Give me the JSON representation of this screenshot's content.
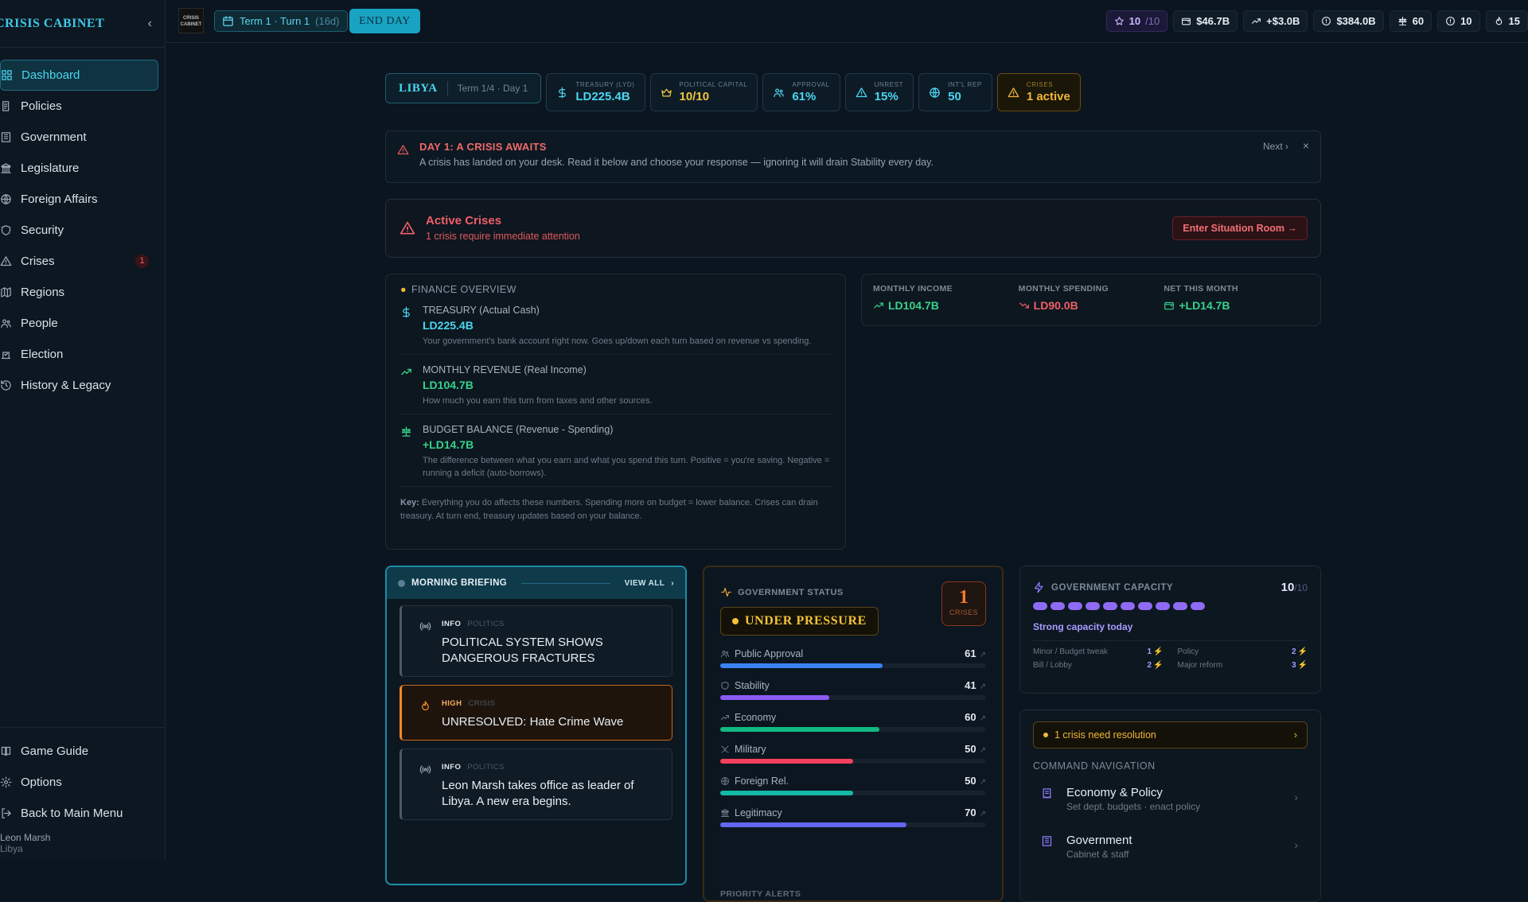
{
  "app": {
    "title": "CRISIS CABINET",
    "collapse_icon": "chevron-left-icon",
    "logo_text": "CRISIS CABINET"
  },
  "sidebar": {
    "items": [
      {
        "label": "Dashboard",
        "icon": "grid-icon",
        "active": true
      },
      {
        "label": "Policies",
        "icon": "scroll-icon"
      },
      {
        "label": "Government",
        "icon": "building-icon"
      },
      {
        "label": "Legislature",
        "icon": "landmark-icon"
      },
      {
        "label": "Foreign Affairs",
        "icon": "globe-icon"
      },
      {
        "label": "Security",
        "icon": "shield-icon"
      },
      {
        "label": "Crises",
        "icon": "warning-icon",
        "badge": "1"
      },
      {
        "label": "Regions",
        "icon": "map-icon"
      },
      {
        "label": "People",
        "icon": "people-icon"
      },
      {
        "label": "Election",
        "icon": "ballot-icon"
      },
      {
        "label": "History & Legacy",
        "icon": "history-icon"
      }
    ],
    "bottom": [
      {
        "label": "Game Guide",
        "icon": "book-icon"
      },
      {
        "label": "Options",
        "icon": "gear-icon"
      },
      {
        "label": "Back to Main Menu",
        "icon": "logout-icon"
      }
    ],
    "user": {
      "name": "Leon Marsh",
      "country": "Libya"
    }
  },
  "topbar": {
    "term": "Term 1 · Turn 1",
    "term_days": "(16d)",
    "end_day": "END DAY",
    "stats": [
      {
        "icon": "star-icon",
        "value": "10",
        "suffix": "/10",
        "kind": "cap"
      },
      {
        "icon": "wallet-icon",
        "value": "$46.7B"
      },
      {
        "icon": "trend-up-icon",
        "value": "+$3.0B"
      },
      {
        "icon": "alert-circle-icon",
        "value": "$384.0B"
      },
      {
        "icon": "scale-icon",
        "value": "60"
      },
      {
        "icon": "alert-circle-icon",
        "value": "10"
      },
      {
        "icon": "flame-icon",
        "value": "15"
      }
    ]
  },
  "country_bar": {
    "name": "LIBYA",
    "term": "Term 1/4 · Day 1",
    "chips": [
      {
        "label": "TREASURY (LYD)",
        "value": "LD225.4B",
        "icon": "dollar-icon"
      },
      {
        "label": "POLITICAL CAPITAL",
        "value": "10/10",
        "icon": "crown-icon",
        "kind": "cap"
      },
      {
        "label": "APPROVAL",
        "value": "61%",
        "icon": "people-icon"
      },
      {
        "label": "UNREST",
        "value": "15%",
        "icon": "warning-icon"
      },
      {
        "label": "INT'L REP",
        "value": "50",
        "icon": "globe-icon"
      },
      {
        "label": "CRISES",
        "value": "1 active",
        "icon": "warning-icon",
        "kind": "warn"
      }
    ]
  },
  "day_alert": {
    "title": "DAY 1: A CRISIS AWAITS",
    "text": "A crisis has landed on your desk. Read it below and choose your response — ignoring it will drain Stability every day.",
    "next": "Next ›",
    "close": "×"
  },
  "active_crises": {
    "title": "Active Crises",
    "subtitle": "1 crisis require immediate attention",
    "button": "Enter Situation Room →"
  },
  "finance": {
    "title": "FINANCE OVERVIEW",
    "rows": [
      {
        "icon": "dollar-icon",
        "title": "TREASURY (Actual Cash)",
        "value": "LD225.4B",
        "color": "#4bd6f0",
        "desc": "Your government's bank account right now. Goes up/down each turn based on revenue vs spending."
      },
      {
        "icon": "trend-up-icon",
        "title": "MONTHLY REVENUE (Real Income)",
        "value": "LD104.7B",
        "color": "#37d38b",
        "desc": "How much you earn this turn from taxes and other sources."
      },
      {
        "icon": "scale-icon",
        "title": "BUDGET BALANCE (Revenue - Spending)",
        "value": "+LD14.7B",
        "color": "#37d38b",
        "desc": "The difference between what you earn and what you spend this turn. Positive = you're saving. Negative = running a deficit (auto-borrows)."
      }
    ],
    "key_label": "Key:",
    "key_text": "Everything you do affects these numbers. Spending more on budget = lower balance. Crises can drain treasury. At turn end, treasury updates based on your balance."
  },
  "monthly": [
    {
      "label": "MONTHLY INCOME",
      "value": "LD104.7B",
      "icon": "trend-up-icon",
      "color": "#37d38b"
    },
    {
      "label": "MONTHLY SPENDING",
      "value": "LD90.0B",
      "icon": "trend-down-icon",
      "color": "#f05f66"
    },
    {
      "label": "NET THIS MONTH",
      "value": "+LD14.7B",
      "icon": "wallet-icon",
      "color": "#37d38b"
    }
  ],
  "briefing": {
    "title": "MORNING BRIEFING",
    "view_all": "VIEW ALL",
    "items": [
      {
        "tag": "INFO",
        "category": "POLITICS",
        "text": "POLITICAL SYSTEM SHOWS DANGEROUS FRACTURES",
        "icon": "broadcast-icon",
        "level": "info"
      },
      {
        "tag": "HIGH",
        "category": "CRISIS",
        "text": "UNRESOLVED: Hate Crime Wave",
        "icon": "flame-icon",
        "level": "high"
      },
      {
        "tag": "INFO",
        "category": "POLITICS",
        "text": "Leon Marsh takes office as leader of Libya. A new era begins.",
        "icon": "broadcast-icon",
        "level": "info"
      }
    ]
  },
  "gov_status": {
    "title": "GOVERNMENT STATUS",
    "status": "UNDER PRESSURE",
    "crises_count": "1",
    "crises_label": "CRISES",
    "metrics": [
      {
        "label": "Public Approval",
        "value": 61,
        "color": "#3b82f6",
        "icon": "people-icon"
      },
      {
        "label": "Stability",
        "value": 41,
        "color": "#8b5cf6",
        "icon": "shield-icon"
      },
      {
        "label": "Economy",
        "value": 60,
        "color": "#10b981",
        "icon": "trend-up-icon"
      },
      {
        "label": "Military",
        "value": 50,
        "color": "#f43f5e",
        "icon": "swords-icon"
      },
      {
        "label": "Foreign Rel.",
        "value": 50,
        "color": "#14b8a6",
        "icon": "globe-icon"
      },
      {
        "label": "Legitimacy",
        "value": 70,
        "color": "#6366f1",
        "icon": "landmark-icon"
      }
    ],
    "priority": "PRIORITY ALERTS"
  },
  "capacity": {
    "title": "GOVERNMENT CAPACITY",
    "value": "10",
    "max": "/10",
    "pips": 10,
    "strong": "Strong capacity today",
    "costs": [
      {
        "label": "Minor / Budget tweak",
        "cost": "1"
      },
      {
        "label": "Policy",
        "cost": "2"
      },
      {
        "label": "Bill / Lobby",
        "cost": "2"
      },
      {
        "label": "Major reform",
        "cost": "3"
      }
    ]
  },
  "command": {
    "resolve": "1 crisis need resolution",
    "title": "COMMAND NAVIGATION",
    "items": [
      {
        "name": "Economy & Policy",
        "sub": "Set dept. budgets · enact policy",
        "icon": "receipt-icon"
      },
      {
        "name": "Government",
        "sub": "Cabinet & staff",
        "icon": "building-icon"
      }
    ]
  }
}
